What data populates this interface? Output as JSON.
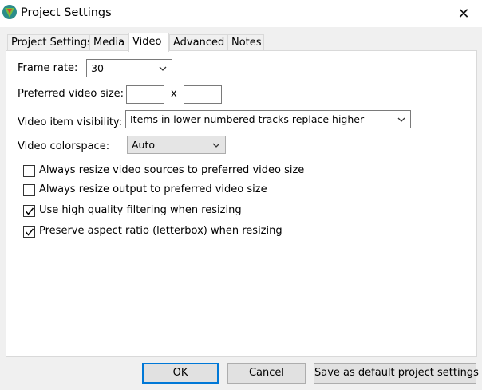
{
  "window": {
    "title": "Project Settings",
    "close_glyph": "✕"
  },
  "tabs": [
    {
      "label": "Project Settings"
    },
    {
      "label": "Media"
    },
    {
      "label": "Video"
    },
    {
      "label": "Advanced"
    },
    {
      "label": "Notes"
    }
  ],
  "active_tab": "Video",
  "video": {
    "frame_rate_label": "Frame rate:",
    "frame_rate_value": "30",
    "preferred_size_label": "Preferred video size:",
    "preferred_width": "",
    "preferred_height": "",
    "size_separator": "x",
    "visibility_label": "Video item visibility:",
    "visibility_value": "Items in lower numbered tracks replace higher",
    "colorspace_label": "Video colorspace:",
    "colorspace_value": "Auto",
    "options": [
      {
        "label": "Always resize video sources to preferred video size",
        "checked": false
      },
      {
        "label": "Always resize output to preferred video size",
        "checked": false
      },
      {
        "label": "Use high quality filtering when resizing",
        "checked": true
      },
      {
        "label": "Preserve aspect ratio (letterbox) when resizing",
        "checked": true
      }
    ]
  },
  "buttons": {
    "ok": "OK",
    "cancel": "Cancel",
    "save_default": "Save as default project settings"
  },
  "colors": {
    "accent": "#0078d7",
    "icon_teal": "#2a8d8a",
    "icon_green": "#7cbb3f",
    "icon_red": "#d9452b"
  }
}
